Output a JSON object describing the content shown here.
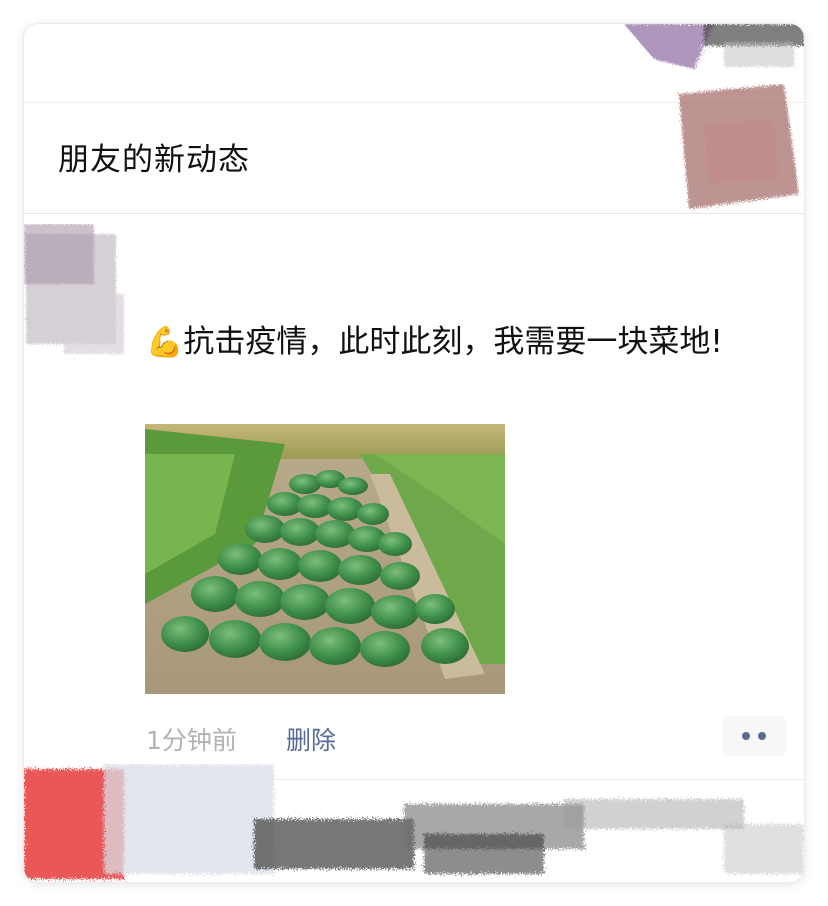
{
  "header": {
    "title": "朋友的新动态"
  },
  "post": {
    "author": "",
    "emoji": "💪",
    "text": "抗击疫情，此时此刻，我需要一块菜地!",
    "image_alt": "菜地",
    "time": "1分钟前",
    "delete_label": "删除",
    "more_icon": "more-dots-icon"
  },
  "colors": {
    "link": "#576b95",
    "time": "#b2b2b2",
    "text": "#111111",
    "divider": "#ececec"
  }
}
